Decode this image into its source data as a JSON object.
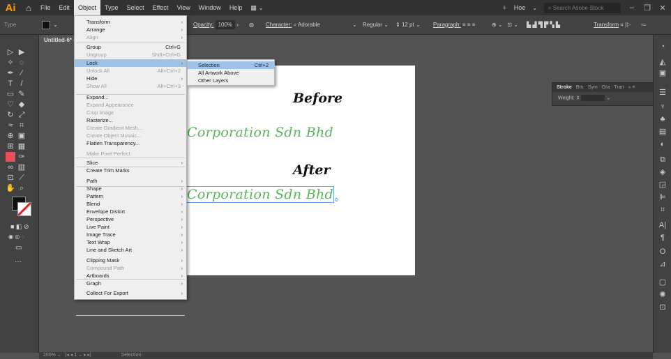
{
  "app": {
    "logo": "Ai"
  },
  "menubar": {
    "items": [
      "File",
      "Edit",
      "Object",
      "Type",
      "Select",
      "Effect",
      "View",
      "Window",
      "Help"
    ],
    "workspace": "Hoe",
    "search_placeholder": "Search Adobe Stock"
  },
  "controlbar": {
    "selection_type": "Type",
    "opacity_label": "Opacity:",
    "opacity_value": "100%",
    "character_label": "Character:",
    "font": "Adorable",
    "style": "Regular",
    "size": "12 pt",
    "paragraph_label": "Paragraph:",
    "transform_label": "Transform"
  },
  "document": {
    "tab": "Untitled-6* @"
  },
  "artboard": {
    "before_heading": "Before",
    "after_heading": "After",
    "logo_text": "Corporation Sdn Bhd"
  },
  "stroke_panel": {
    "tabs": [
      "Stroke",
      "Bru",
      "Sym",
      "Gra",
      "Tran"
    ],
    "weight_label": "Weight:"
  },
  "object_menu": {
    "items": [
      {
        "label": "Transform",
        "submenu": true
      },
      {
        "label": "Arrange",
        "submenu": true
      },
      {
        "label": "Align",
        "submenu": true,
        "disabled": true
      },
      {
        "label": "Group",
        "shortcut": "Ctrl+G"
      },
      {
        "label": "Ungroup",
        "shortcut": "Shift+Ctrl+G",
        "disabled": true
      },
      {
        "label": "Lock",
        "submenu": true,
        "highlight": true
      },
      {
        "label": "Unlock All",
        "shortcut": "Alt+Ctrl+2",
        "disabled": true
      },
      {
        "label": "Hide",
        "submenu": true
      },
      {
        "label": "Show All",
        "shortcut": "Alt+Ctrl+3",
        "disabled": true
      },
      {
        "label": "Expand..."
      },
      {
        "label": "Expand Appearance",
        "disabled": true
      },
      {
        "label": "Crop Image",
        "disabled": true
      },
      {
        "label": "Rasterize..."
      },
      {
        "label": "Create Gradient Mesh...",
        "disabled": true
      },
      {
        "label": "Create Object Mosaic...",
        "disabled": true
      },
      {
        "label": "Flatten Transparency..."
      },
      {
        "label": "Make Pixel Perfect",
        "disabled": true
      },
      {
        "label": "Slice",
        "submenu": true
      },
      {
        "label": "Create Trim Marks"
      },
      {
        "label": "Path",
        "submenu": true
      },
      {
        "label": "Shape",
        "submenu": true
      },
      {
        "label": "Pattern",
        "submenu": true
      },
      {
        "label": "Blend",
        "submenu": true
      },
      {
        "label": "Envelope Distort",
        "submenu": true
      },
      {
        "label": "Perspective",
        "submenu": true
      },
      {
        "label": "Live Paint",
        "submenu": true
      },
      {
        "label": "Image Trace",
        "submenu": true
      },
      {
        "label": "Text Wrap",
        "submenu": true
      },
      {
        "label": "Line and Sketch Art",
        "submenu": true
      },
      {
        "label": "Clipping Mask",
        "submenu": true
      },
      {
        "label": "Compound Path",
        "submenu": true,
        "disabled": true
      },
      {
        "label": "Artboards",
        "submenu": true
      },
      {
        "label": "Graph",
        "submenu": true
      },
      {
        "label": "Collect For Export",
        "submenu": true
      }
    ]
  },
  "lock_submenu": {
    "items": [
      {
        "label": "Selection",
        "shortcut": "Ctrl+2",
        "highlight": true
      },
      {
        "label": "All Artwork Above"
      },
      {
        "label": "Other Layers"
      }
    ]
  },
  "status": {
    "zoom": "200%",
    "page": "1",
    "tool": "Selection"
  },
  "colors": {
    "accent_logo": "#ff9a00",
    "logo_green": "#59b55b",
    "menu_highlight": "#9fc3e8"
  }
}
